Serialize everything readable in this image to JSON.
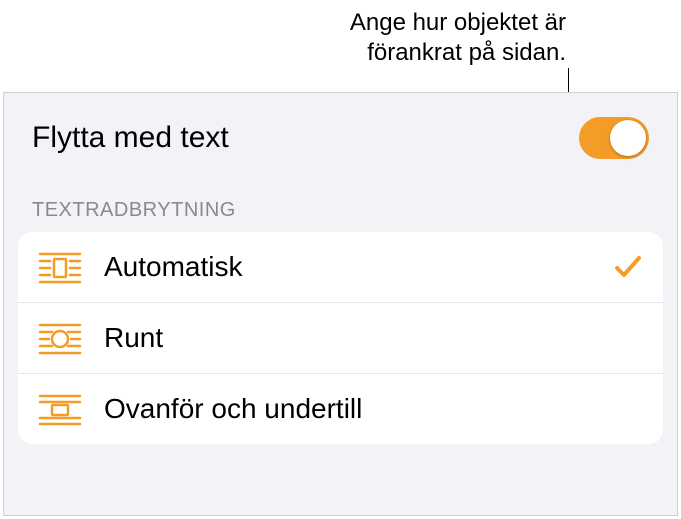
{
  "callout": {
    "line1": "Ange hur objektet är",
    "line2": "förankrat på sidan."
  },
  "toggle": {
    "label": "Flytta med text",
    "state": "on"
  },
  "section": {
    "header": "TEXTRADBRYTNING",
    "items": [
      {
        "label": "Automatisk",
        "selected": true,
        "icon": "wrap-auto-icon"
      },
      {
        "label": "Runt",
        "selected": false,
        "icon": "wrap-around-icon"
      },
      {
        "label": "Ovanför och undertill",
        "selected": false,
        "icon": "wrap-above-below-icon"
      }
    ]
  },
  "colors": {
    "accent": "#f59c26"
  }
}
